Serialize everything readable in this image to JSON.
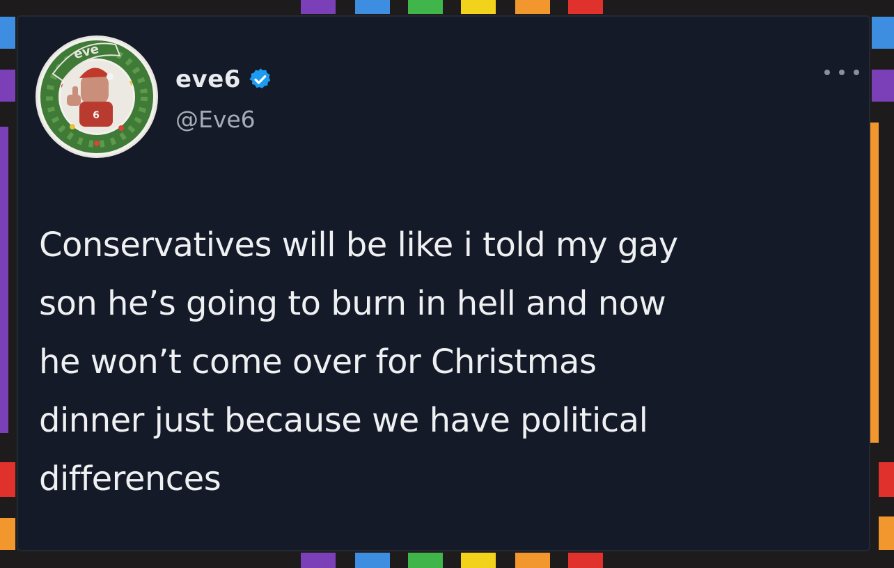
{
  "tweet": {
    "display_name": "eve6",
    "handle": "@Eve6",
    "verified_icon": "verified-badge-icon",
    "more_icon": "more-options-icon",
    "avatar_badge_text": "eve",
    "text": "Conservatives will be like i told my gay\nson he’s going to burn in hell and now\nhe won’t come over for Christmas\ndinner just because we have political\ndifferences"
  },
  "colors": {
    "card_background": "#151a28",
    "border_background": "#1e1b1c",
    "verified_blue": "#1d9bf0",
    "stripe_purple": "#7b3fb8",
    "stripe_blue": "#3d8ee0",
    "stripe_green": "#3fb54a",
    "stripe_yellow": "#f2d21b",
    "stripe_orange": "#f2962e",
    "stripe_red": "#e0312c"
  }
}
